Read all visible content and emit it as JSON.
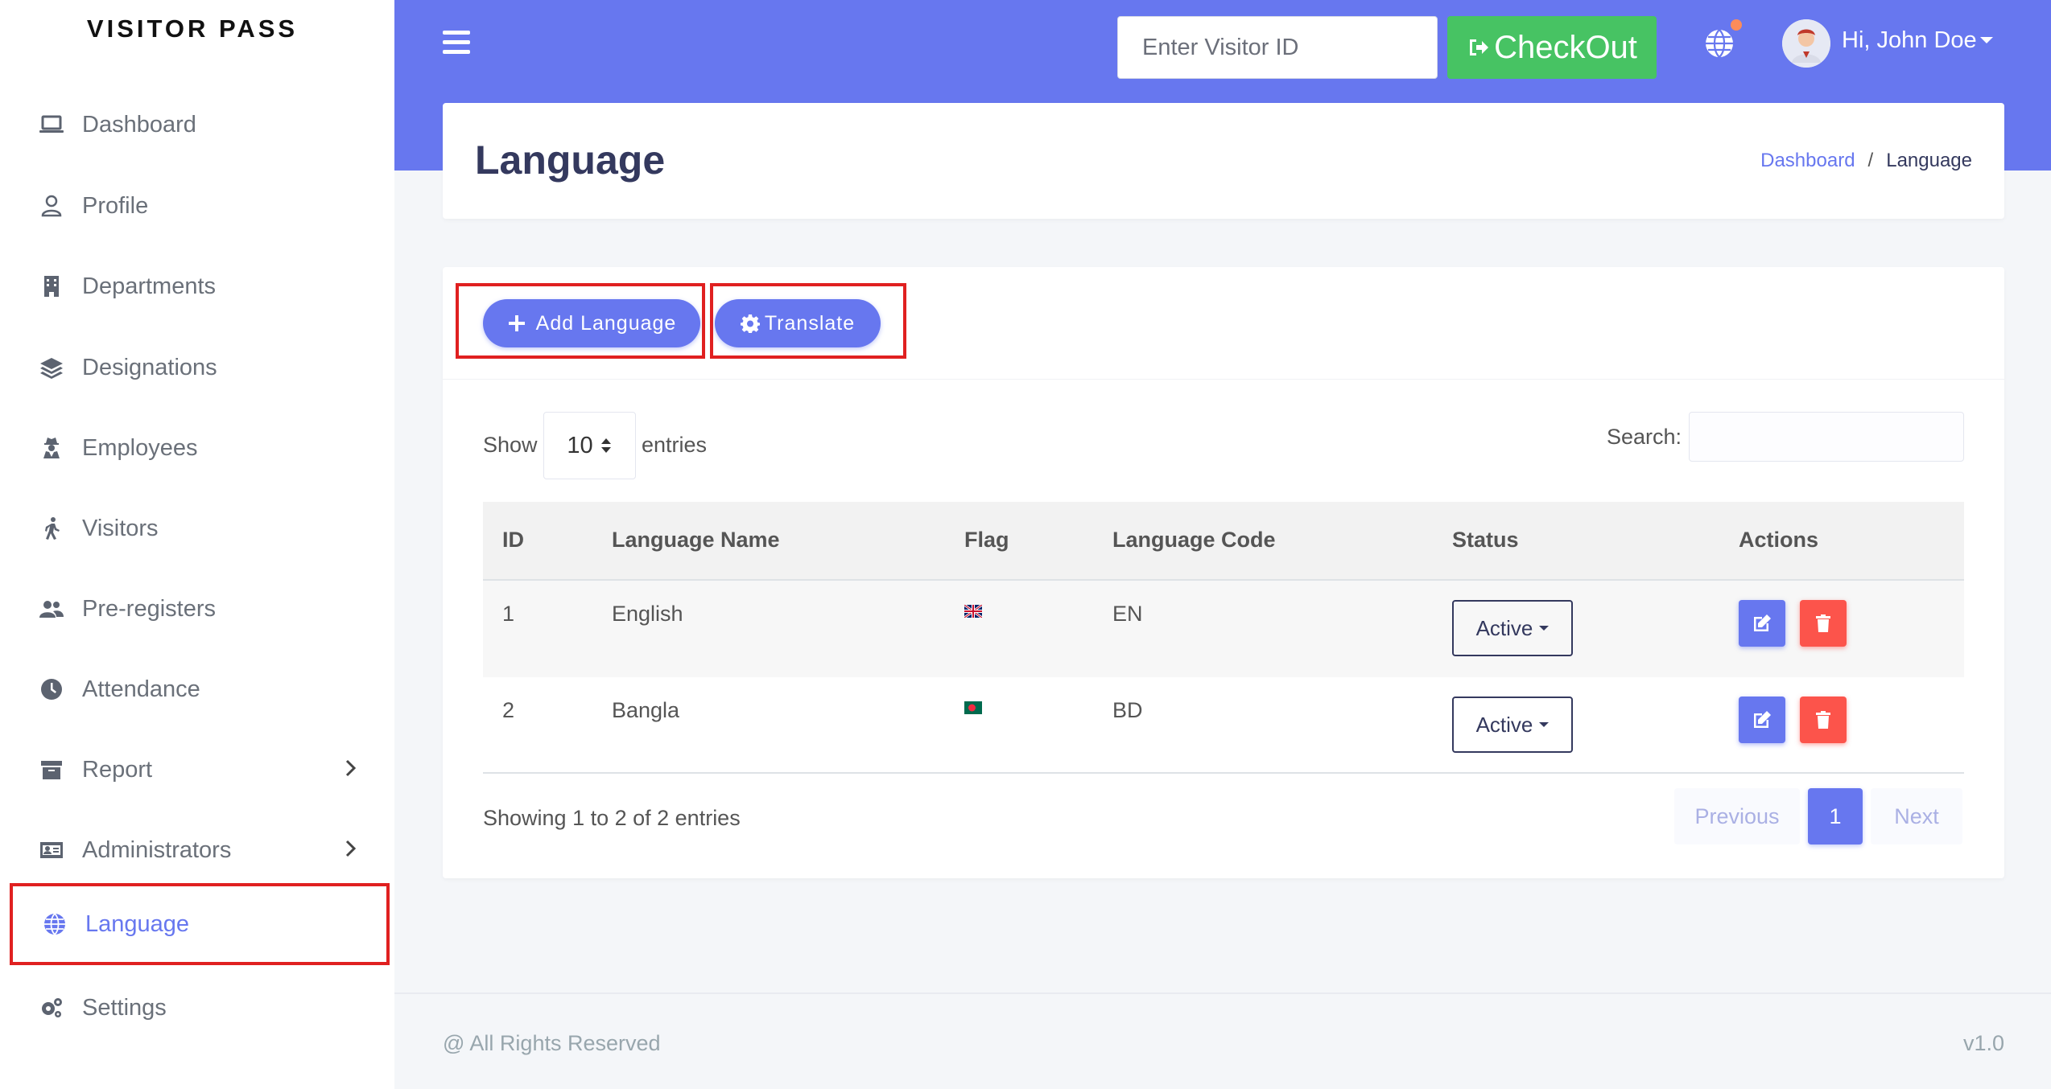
{
  "brand": "VISITOR PASS",
  "sidebar": {
    "items": [
      {
        "label": "Dashboard",
        "icon": "laptop-icon"
      },
      {
        "label": "Profile",
        "icon": "user-icon"
      },
      {
        "label": "Departments",
        "icon": "building-icon"
      },
      {
        "label": "Designations",
        "icon": "layers-icon"
      },
      {
        "label": "Employees",
        "icon": "user-secret-icon"
      },
      {
        "label": "Visitors",
        "icon": "walking-icon"
      },
      {
        "label": "Pre-registers",
        "icon": "users-icon"
      },
      {
        "label": "Attendance",
        "icon": "clock-icon"
      },
      {
        "label": "Report",
        "icon": "archive-icon",
        "has_submenu": true
      },
      {
        "label": "Administrators",
        "icon": "id-card-icon",
        "has_submenu": true
      },
      {
        "label": "Language",
        "icon": "globe-icon",
        "active": true
      },
      {
        "label": "Settings",
        "icon": "cogs-icon"
      }
    ]
  },
  "topbar": {
    "visitor_placeholder": "Enter Visitor ID",
    "checkout_label": "CheckOut",
    "user_greeting": "Hi, John Doe"
  },
  "header": {
    "title": "Language",
    "breadcrumb": {
      "home": "Dashboard",
      "separator": "/",
      "current": "Language"
    }
  },
  "toolbar": {
    "add_label": "Add Language",
    "translate_label": "Translate"
  },
  "table_controls": {
    "show_label": "Show",
    "entries_value": "10",
    "entries_label": "entries",
    "search_label": "Search:"
  },
  "table": {
    "columns": [
      "ID",
      "Language Name",
      "Flag",
      "Language Code",
      "Status",
      "Actions"
    ],
    "rows": [
      {
        "id": "1",
        "name": "English",
        "flag": "uk-flag",
        "code": "EN",
        "status": "Active"
      },
      {
        "id": "2",
        "name": "Bangla",
        "flag": "bd-flag",
        "code": "BD",
        "status": "Active"
      }
    ]
  },
  "pagination": {
    "info": "Showing 1 to 2 of 2 entries",
    "previous": "Previous",
    "current": "1",
    "next": "Next"
  },
  "footer": {
    "left": "@ All Rights Reserved",
    "right": "v1.0"
  },
  "colors": {
    "primary": "#6777ef",
    "success": "#47c363",
    "danger": "#fc544b",
    "highlight": "#e02020"
  }
}
